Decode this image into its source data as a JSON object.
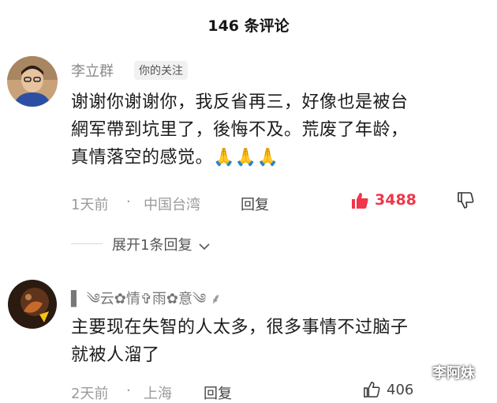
{
  "header": {
    "comment_count": "146",
    "title_suffix": "条评论"
  },
  "comments": [
    {
      "username": "李立群",
      "badge": "你的关注",
      "content_lines": [
        "谢谢你谢谢你，我反省再三，好像也是被台",
        "網军帶到坑里了，後悔不及。荒废了年龄，",
        "真情落空的感觉。"
      ],
      "emoji": "🙏🙏🙏",
      "time": "1天前",
      "location": "中国台湾",
      "reply_label": "回复",
      "likes": "3488",
      "expand_label": "展开1条回复"
    },
    {
      "username": "▌ ༄云✿情✞雨✿意༄ ⸙",
      "content_lines": [
        "主要现在失智的人太多，很多事情不过脑子",
        "就被人溜了"
      ],
      "time": "2天前",
      "location": "上海",
      "reply_label": "回复",
      "likes": "406"
    }
  ],
  "watermark": "李阿妹",
  "colors": {
    "like_active": "#f0364a",
    "meta_gray": "#9a9a9a"
  }
}
